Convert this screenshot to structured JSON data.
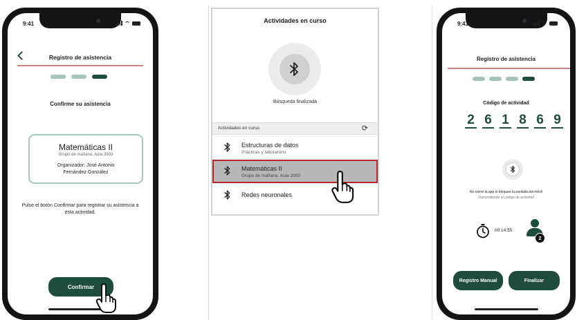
{
  "status_bar": {
    "time": "9:41"
  },
  "screen1": {
    "title": "Registro de asistencia",
    "heading": "Confirme su asistencia",
    "course": {
      "name": "Matemáticas II",
      "group": "Grupo de mañana. Aula 2003",
      "organizer_line1": "Organizador: José Antonio",
      "organizer_line2": "Fernández González"
    },
    "instruction_before": "Pulse el botón ",
    "instruction_emph": "Confirmar",
    "instruction_after": " para registrar su asistencia a esta actividad.",
    "confirm_label": "Confirmar",
    "progress_step": "3 of 3"
  },
  "screen2": {
    "title": "Actividades en curso",
    "search_status": "Búsqueda finalizada",
    "list_header": "Actividades en curso",
    "items": [
      {
        "title": "Estructuras de datos",
        "subtitle": "Prácticas y laboratorio",
        "selected": false
      },
      {
        "title": "Matemáticas II",
        "subtitle": "Grupo de mañana. Aula 2003",
        "selected": true
      },
      {
        "title": "Redes neuronales",
        "subtitle": "",
        "selected": false
      }
    ]
  },
  "screen3": {
    "title": "Registro de asistencia",
    "code_label": "Código de actividad",
    "code_digits": [
      "2",
      "6",
      "1",
      "8",
      "6",
      "9"
    ],
    "warning": "No cierre la app ni bloquee la pantalla del móvil",
    "transmitting": "Transmitiendo el código de actividad",
    "elapsed": "00:14:55",
    "attendees": "2",
    "manual_label": "Registro Manual",
    "finish_label": "Finalizar",
    "progress_step": "4 of 4"
  },
  "colors": {
    "primary_green": "#1f4d3c",
    "light_green": "#a7c4b8",
    "accent_red": "#c98383",
    "selection_border": "#b3262b"
  },
  "icons": [
    "back-chevron-icon",
    "bluetooth-icon",
    "refresh-icon",
    "pointer-hand-icon",
    "stopwatch-icon",
    "person-icon"
  ]
}
